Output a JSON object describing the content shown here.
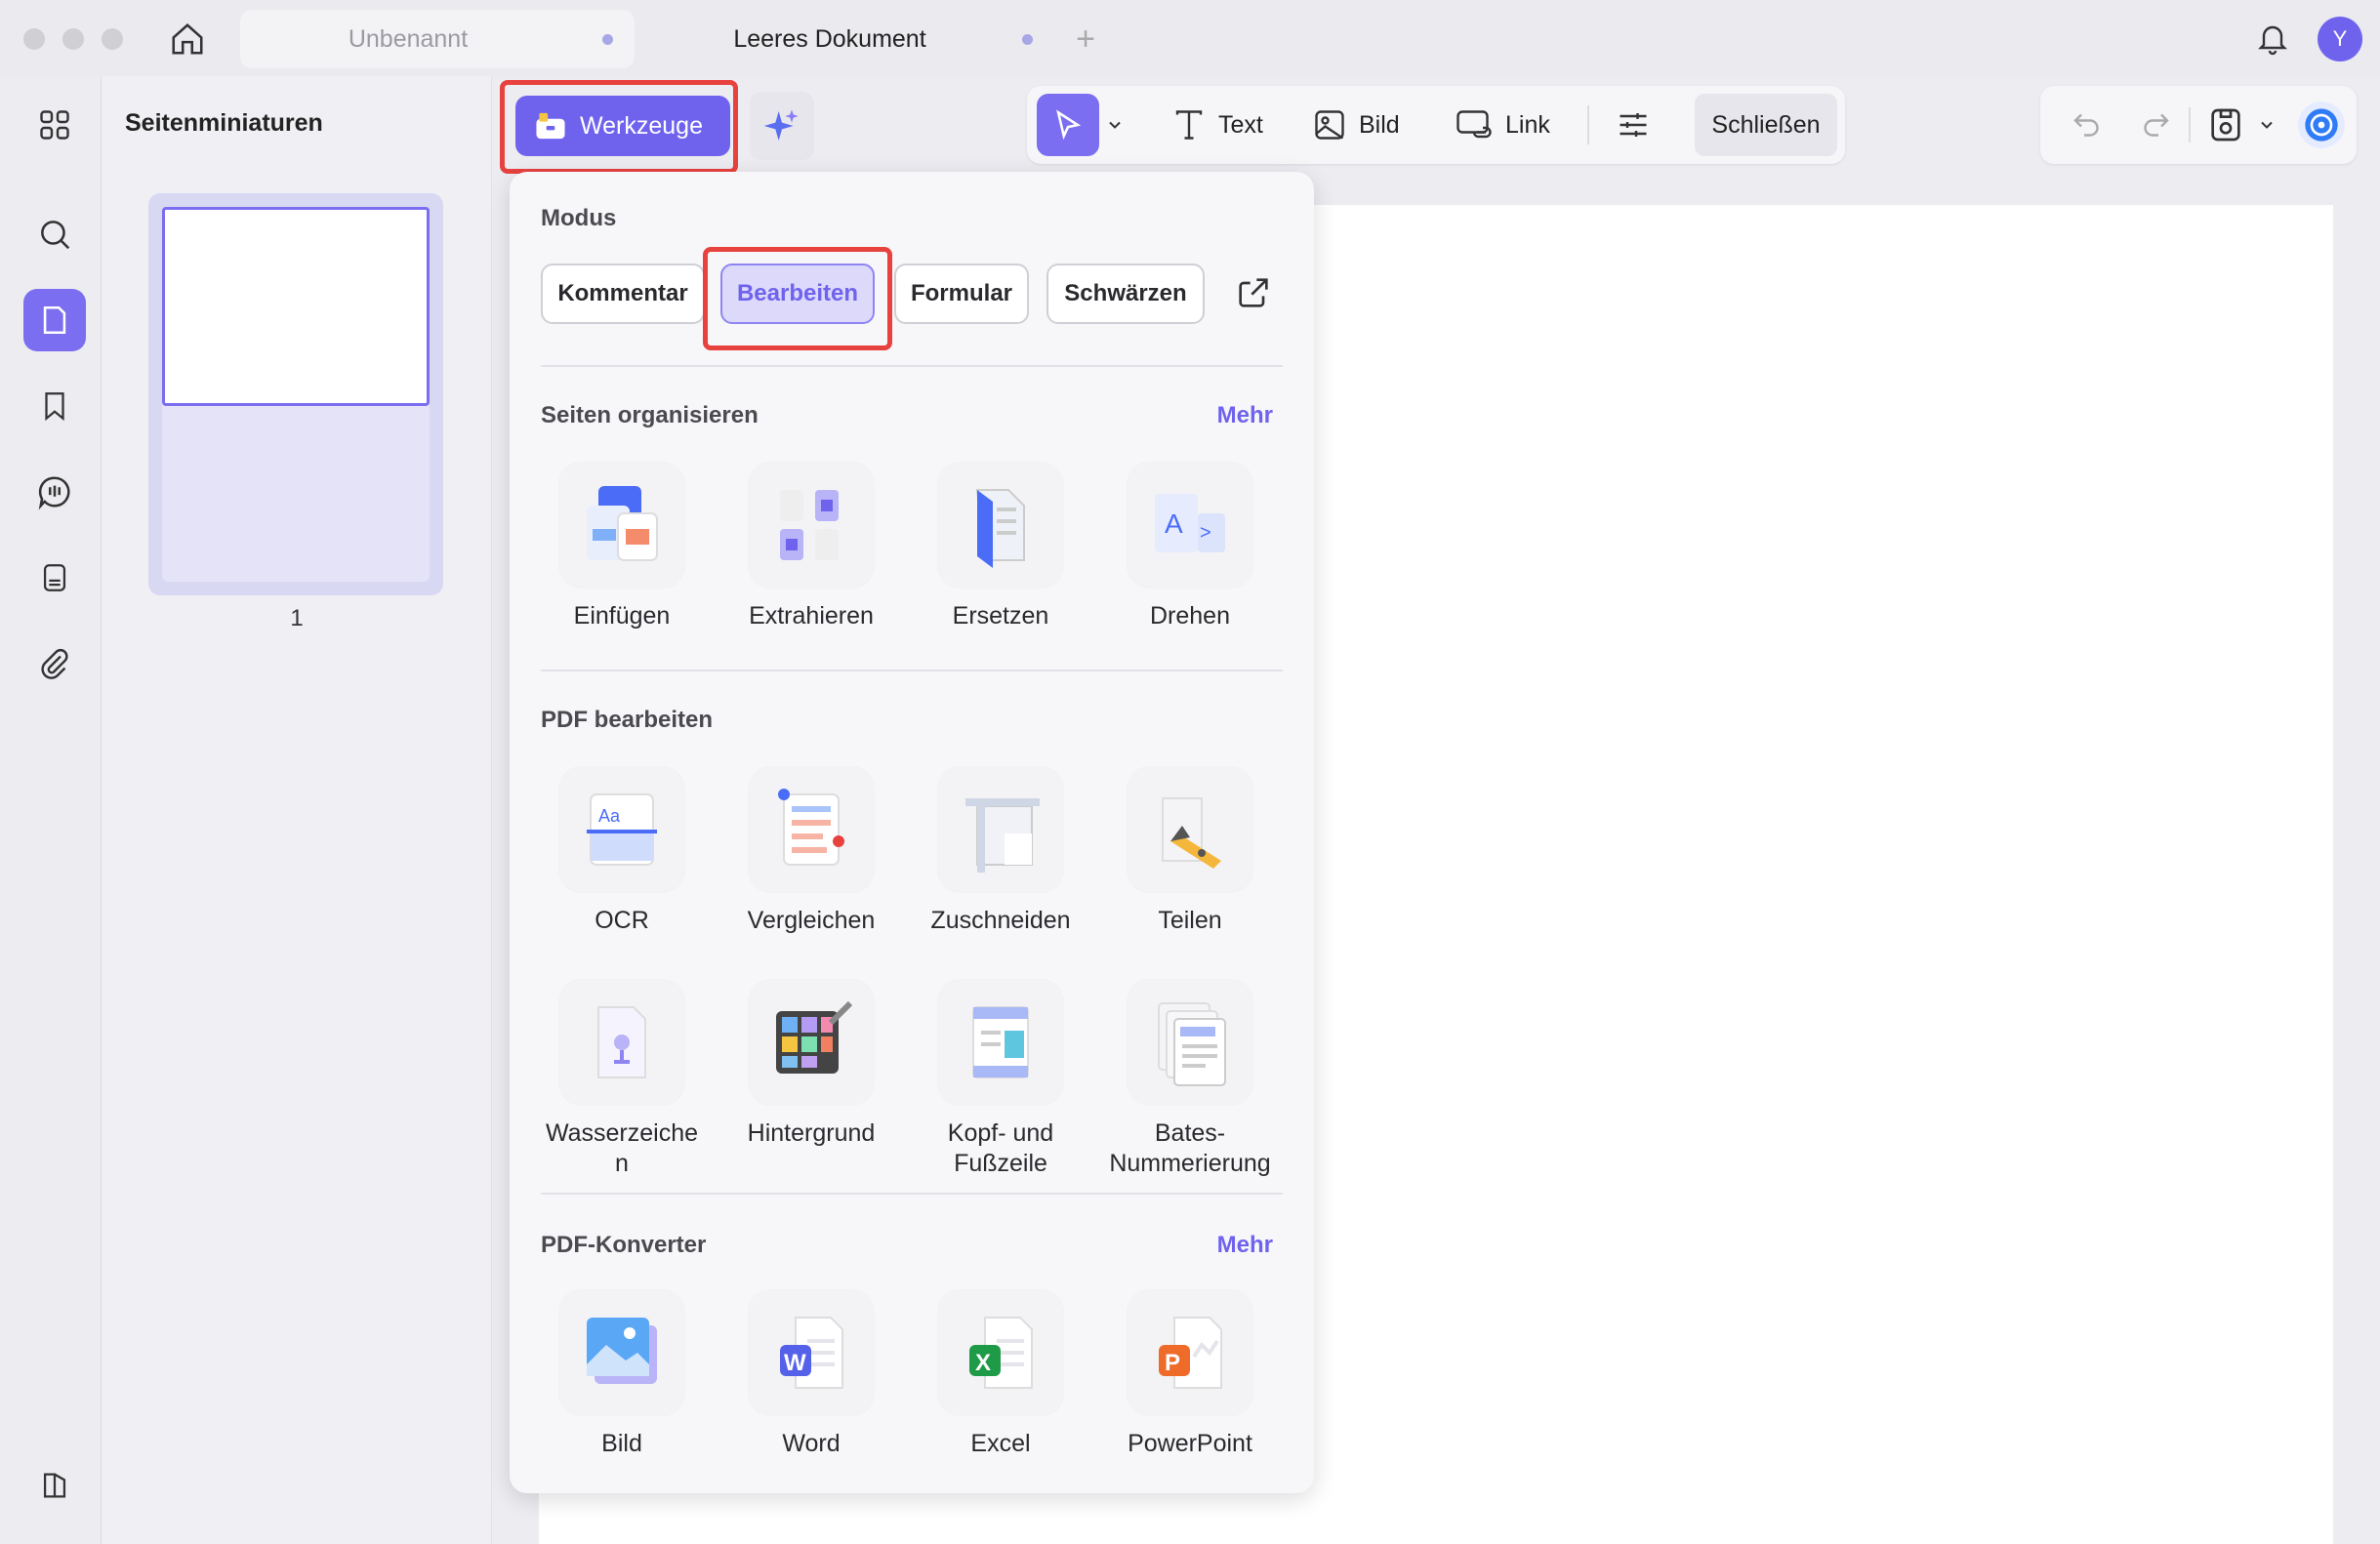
{
  "titlebar": {
    "tabs": [
      {
        "label": "Unbenannt",
        "active": false
      },
      {
        "label": "Leeres Dokument",
        "active": true
      }
    ],
    "avatar_initial": "Y"
  },
  "thumbnails": {
    "title": "Seitenminiaturen",
    "page_number": "1"
  },
  "toolbar": {
    "werkzeuge_label": "Werkzeuge",
    "text_label": "Text",
    "bild_label": "Bild",
    "link_label": "Link",
    "close_label": "Schließen"
  },
  "panel": {
    "modus_title": "Modus",
    "modes": [
      "Kommentar",
      "Bearbeiten",
      "Formular",
      "Schwärzen"
    ],
    "selected_mode": "Bearbeiten",
    "organize_title": "Seiten organisieren",
    "more_label": "Mehr",
    "organize_tools": [
      "Einfügen",
      "Extrahieren",
      "Ersetzen",
      "Drehen"
    ],
    "edit_title": "PDF bearbeiten",
    "edit_tools": [
      "OCR",
      "Vergleichen",
      "Zuschneiden",
      "Teilen",
      "Wasserzeiche\nn",
      "Hintergrund",
      "Kopf- und\nFußzeile",
      "Bates-\nNummerierung"
    ],
    "converter_title": "PDF-Konverter",
    "converter_tools": [
      "Bild",
      "Word",
      "Excel",
      "PowerPoint"
    ]
  },
  "colors": {
    "accent": "#6f63ee",
    "highlight_box": "#e8423f"
  }
}
